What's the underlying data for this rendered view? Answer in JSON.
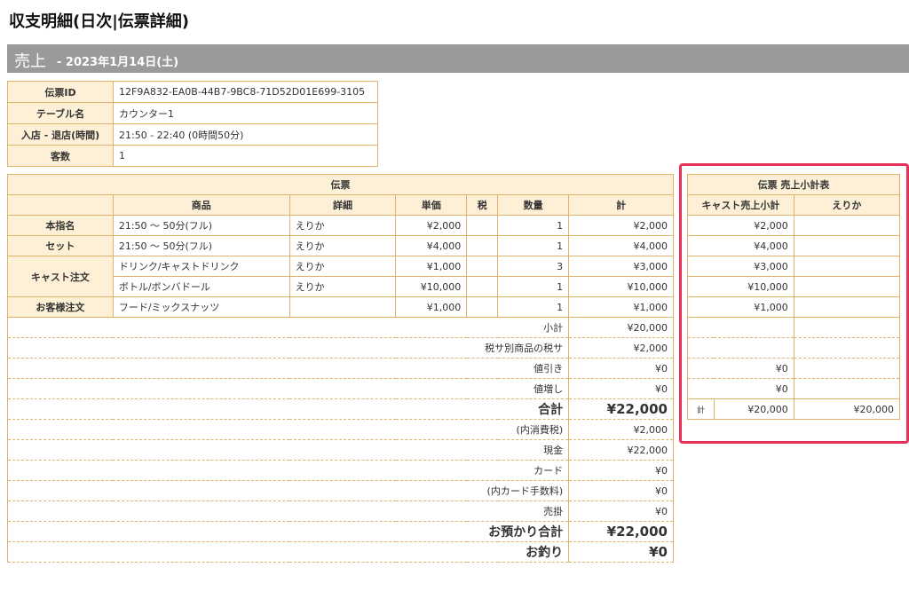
{
  "page": {
    "title": "収支明細(日次|伝票詳細)"
  },
  "section": {
    "label": "売上",
    "date": "- 2023年1月14日(土)"
  },
  "info": [
    {
      "label": "伝票ID",
      "value": "12F9A832-EA0B-44B7-9BC8-71D52D01E699-3105"
    },
    {
      "label": "テーブル名",
      "value": "カウンター1"
    },
    {
      "label": "入店 - 退店(時間)",
      "value": "21:50 - 22:40 (0時間50分)"
    },
    {
      "label": "客数",
      "value": "1"
    }
  ],
  "slip": {
    "title": "伝票",
    "headers": {
      "item": "商品",
      "detail": "詳細",
      "unit": "単価",
      "tax": "税",
      "qty": "数量",
      "total": "計"
    },
    "rows": [
      {
        "category": "本指名",
        "item": "21:50 〜 50分(フル)",
        "detail": "えりか",
        "unit": "¥2,000",
        "tax": "",
        "qty": "1",
        "total": "¥2,000"
      },
      {
        "category": "セット",
        "item": "21:50 〜 50分(フル)",
        "detail": "えりか",
        "unit": "¥4,000",
        "tax": "",
        "qty": "1",
        "total": "¥4,000"
      },
      {
        "category": "キャスト注文",
        "item": "ドリンク/キャストドリンク",
        "detail": "えりか",
        "unit": "¥1,000",
        "tax": "",
        "qty": "3",
        "total": "¥3,000"
      },
      {
        "category": "",
        "item": "ボトル/ボンバドール",
        "detail": "えりか",
        "unit": "¥10,000",
        "tax": "",
        "qty": "1",
        "total": "¥10,000"
      },
      {
        "category": "お客様注文",
        "item": "フード/ミックスナッツ",
        "detail": "",
        "unit": "¥1,000",
        "tax": "",
        "qty": "1",
        "total": "¥1,000"
      }
    ],
    "summary": [
      {
        "label": "小計",
        "value": "¥20,000"
      },
      {
        "label": "税サ別商品の税サ",
        "value": "¥2,000"
      },
      {
        "label": "値引き",
        "value": "¥0"
      },
      {
        "label": "値増し",
        "value": "¥0"
      },
      {
        "label": "合計",
        "value": "¥22,000"
      },
      {
        "label": "(内消費税)",
        "value": "¥2,000"
      },
      {
        "label": "現金",
        "value": "¥22,000"
      },
      {
        "label": "カード",
        "value": "¥0"
      },
      {
        "label": "(内カード手数料)",
        "value": "¥0"
      },
      {
        "label": "売掛",
        "value": "¥0"
      },
      {
        "label": "お預かり合計",
        "value": "¥22,000"
      },
      {
        "label": "お釣り",
        "value": "¥0"
      }
    ]
  },
  "subtotal": {
    "title": "伝票 売上小計表",
    "headers": {
      "cast": "キャスト売上小計",
      "name": "えりか"
    },
    "rows": [
      {
        "value": "¥2,000",
        "name": ""
      },
      {
        "value": "¥4,000",
        "name": ""
      },
      {
        "value": "¥3,000",
        "name": ""
      },
      {
        "value": "¥10,000",
        "name": ""
      },
      {
        "value": "¥1,000",
        "name": ""
      },
      {
        "value": "",
        "name": ""
      },
      {
        "value": "",
        "name": ""
      },
      {
        "value": "¥0",
        "name": ""
      },
      {
        "value": "¥0",
        "name": ""
      }
    ],
    "total": {
      "label": "計",
      "value": "¥20,000",
      "name": "¥20,000"
    }
  },
  "colors": {
    "border": "#e0b26a",
    "header_bg": "#fdf0d6",
    "section_bg": "#9a9a9a",
    "highlight": "#e4325a"
  }
}
